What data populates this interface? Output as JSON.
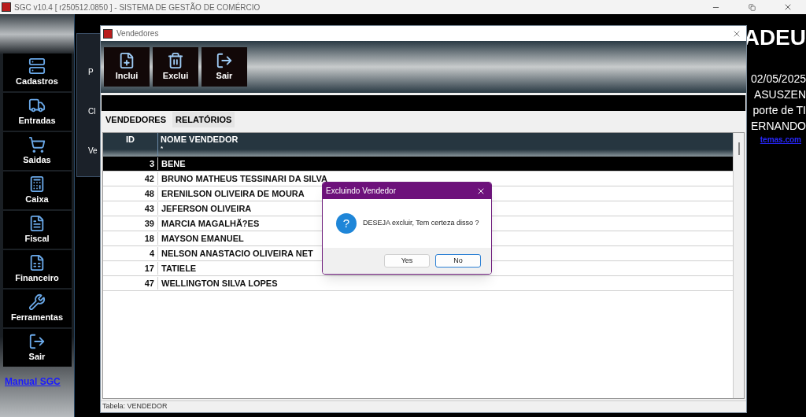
{
  "app_window": {
    "title": "SGC v10.4 [ r250512.0850 ] - SISTEMA DE GESTÃO DE COMÉRCIO"
  },
  "sidebar": {
    "items": [
      {
        "label": "Cadastros",
        "kind": "cadastros"
      },
      {
        "label": "Entradas",
        "kind": "entradas"
      },
      {
        "label": "Saidas",
        "kind": "saidas"
      },
      {
        "label": "Caixa",
        "kind": "caixa"
      },
      {
        "label": "Fiscal",
        "kind": "fiscal"
      },
      {
        "label": "Financeiro",
        "kind": "financeiro"
      },
      {
        "label": "Ferramentas",
        "kind": "ferramentas"
      },
      {
        "label": "Sair",
        "kind": "sair"
      }
    ],
    "link": "Manual SGC"
  },
  "background_window": {
    "labels": [
      "P",
      "Cl",
      "Ve"
    ]
  },
  "background_info": {
    "heading": "ADEU",
    "lines": [
      "02/05/2025",
      "ASUSZEN",
      "porte de TI",
      "ERNANDO"
    ],
    "link": "temas.com"
  },
  "child_window": {
    "title": "Vendedores",
    "toolbar": [
      {
        "label": "Inclui",
        "kind": "add"
      },
      {
        "label": "Exclui",
        "kind": "delete"
      },
      {
        "label": "Sair",
        "kind": "exit"
      }
    ],
    "tabs": [
      {
        "label": "VENDEDORES",
        "selected": true
      },
      {
        "label": "RELATÓRIOS",
        "selected": false
      }
    ],
    "table": {
      "columns": [
        {
          "label": "ID"
        },
        {
          "label": "NOME VENDEDOR",
          "sub": "*"
        }
      ],
      "rows": [
        {
          "id": "3",
          "name": "BENE",
          "selected": true
        },
        {
          "id": "42",
          "name": "BRUNO MATHEUS TESSINARI DA SILVA",
          "selected": false
        },
        {
          "id": "48",
          "name": "ERENILSON OLIVEIRA DE MOURA",
          "selected": false
        },
        {
          "id": "43",
          "name": "JEFERSON OLIVEIRA",
          "selected": false
        },
        {
          "id": "39",
          "name": "MARCIA MAGALHÃ?ES",
          "selected": false
        },
        {
          "id": "18",
          "name": "MAYSON EMANUEL",
          "selected": false
        },
        {
          "id": "4",
          "name": "NELSON ANASTACIO OLIVEIRA NET",
          "selected": false
        },
        {
          "id": "17",
          "name": "TATIELE",
          "selected": false
        },
        {
          "id": "47",
          "name": "WELLINGTON SILVA LOPES",
          "selected": false
        }
      ]
    },
    "status_bar": "Tabela: VENDEDOR"
  },
  "dialog": {
    "title": "Excluindo Vendedor",
    "icon_glyph": "?",
    "message": "DESEJA excluir, Tem certeza disso ?",
    "buttons": [
      {
        "label": "Yes",
        "selected": false
      },
      {
        "label": "No",
        "selected": true
      }
    ]
  }
}
